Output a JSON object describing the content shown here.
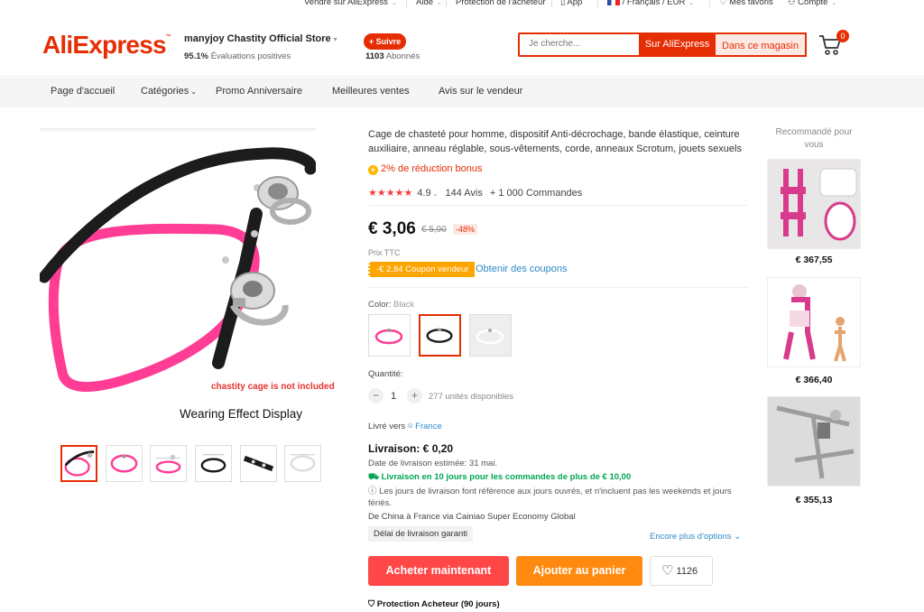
{
  "topbar": {
    "sell": "Vendre sur AliExpress",
    "help": "Aide",
    "protection": "Protection de l'acheteur",
    "app": "App",
    "locale": "/ Français / EUR",
    "wishlist": "Mes favoris",
    "account": "Compte"
  },
  "header": {
    "logo": "AliExpress",
    "store_name": "manyjoy Chastity Official Store",
    "store_rating_value": "95.1%",
    "store_rating_label": "Évaluations positives",
    "follow_label": "+ Suivre",
    "followers_count": "1103",
    "followers_label": "Abonnés",
    "cart_count": "0"
  },
  "search": {
    "placeholder": "Je cherche...",
    "btn_all": "Sur AliExpress",
    "btn_store": "Dans ce magasin"
  },
  "nav": {
    "items": [
      "Page d'accueil",
      "Catégories",
      "Promo Anniversaire",
      "Meilleures ventes",
      "Avis sur le vendeur"
    ]
  },
  "gallery": {
    "note": "chastity cage is not included",
    "caption": "Wearing Effect Display",
    "thumbs": [
      "thumb-1",
      "thumb-2",
      "thumb-3",
      "thumb-4",
      "thumb-5",
      "thumb-6"
    ],
    "selected_thumb": 0
  },
  "product": {
    "title": "Cage de chasteté pour homme, dispositif Anti-décrochage, bande élastique, ceinture auxiliaire, anneau réglable, sous-vêtements, corde, anneaux Scrotum, jouets sexuels",
    "bonus": "2% de réduction bonus",
    "rating": "4.9",
    "reviews": "144 Avis",
    "orders": "+ 1 000 Commandes",
    "price": "€ 3,06",
    "old_price": "€ 5,90",
    "discount": "-48%",
    "tax_note": "Prix TTC",
    "coupon": "-€ 2,84 Coupon vendeur",
    "coupon_link": "Obtenir des coupons",
    "color_label": "Color:",
    "color_value": "Black",
    "colors": [
      "Pink",
      "Black",
      "Clear"
    ],
    "selected_color": 1,
    "quantity_label": "Quantité:",
    "quantity": "1",
    "stock": "277 unités disponibles"
  },
  "shipping": {
    "ship_to_label": "Livré vers",
    "ship_to": "France",
    "delivery": "Livraison: € 0,20",
    "estimate": "Date de livraison estimée: 31 mai.",
    "fast": "Livraison en 10 jours pour les commandes de plus de € 10,00",
    "note": "Les jours de livraison font référence aux jours ouvrés, et n'incluent pas les weekends et jours fériés.",
    "via": "De China à France via Cainiao Super Economy Global",
    "guarantee": "Délai de livraison garanti",
    "more_options": "Encore plus d'options"
  },
  "actions": {
    "buy_now": "Acheter maintenant",
    "add_cart": "Ajouter au panier",
    "wishlist_count": "1126",
    "protection": "Protection Acheteur (90 jours)"
  },
  "recommended": {
    "title": "Recommandé pour vous",
    "items": [
      {
        "price": "€ 367,55"
      },
      {
        "price": "€ 366,40"
      },
      {
        "price": "€ 355,13"
      }
    ]
  },
  "colors": {
    "brand": "#e62e04",
    "buy": "#ff4747",
    "cart": "#ff8a0f",
    "link": "#2e8ac9",
    "success": "#00a656"
  }
}
